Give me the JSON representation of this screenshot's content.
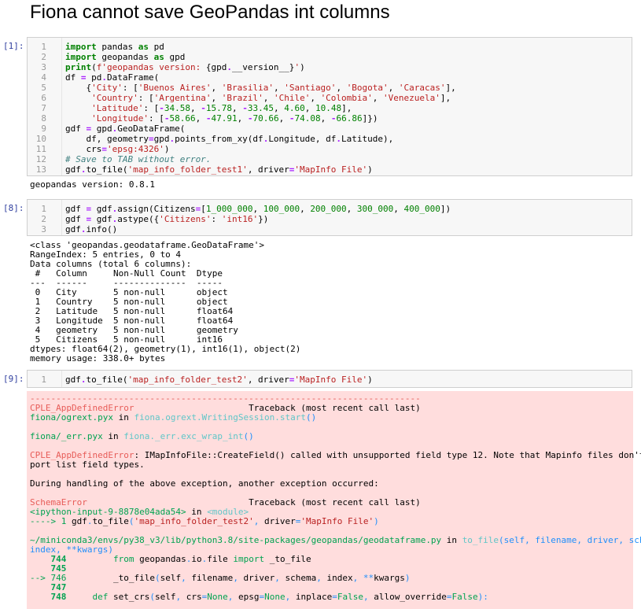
{
  "page": {
    "title": "Fiona cannot save GeoPandas int columns"
  },
  "cells": [
    {
      "prompt": "[1]:",
      "line_numbers": [
        "1",
        "2",
        "3",
        "4",
        "5",
        "6",
        "7",
        "8",
        "9",
        "10",
        "11",
        "12",
        "13"
      ]
    },
    {
      "prompt": "[8]:",
      "line_numbers": [
        "1",
        "2",
        "3"
      ]
    },
    {
      "prompt": "[9]:",
      "line_numbers": [
        "1"
      ]
    }
  ],
  "outputs": {
    "version": "geopandas version: 0.8.1",
    "info": "<class 'geopandas.geodataframe.GeoDataFrame'>\nRangeIndex: 5 entries, 0 to 4\nData columns (total 6 columns):\n #   Column     Non-Null Count  Dtype   \n---  ------     --------------  -----   \n 0   City       5 non-null      object  \n 1   Country    5 non-null      object  \n 2   Latitude   5 non-null      float64 \n 3   Longitude  5 non-null      float64 \n 4   geometry   5 non-null      geometry\n 5   Citizens   5 non-null      int16   \ndtypes: float64(2), geometry(1), int16(1), object(2)\nmemory usage: 338.0+ bytes"
  }
}
